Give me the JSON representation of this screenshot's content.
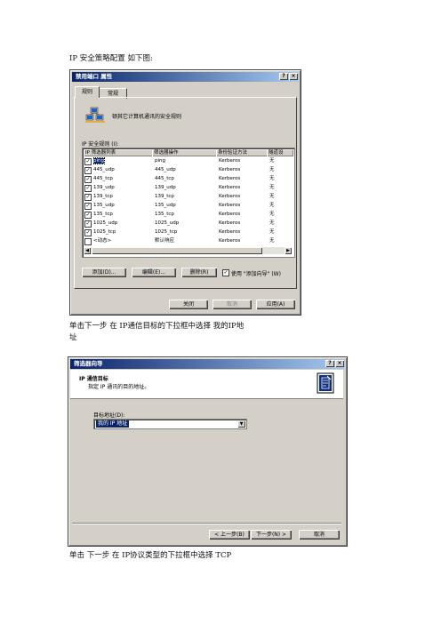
{
  "paragraphs": {
    "intro": "IP 安全策略配置 如下图:",
    "step1_line1": "单击下一步 在 IP通信目标的下拉框中选择 我的IP地",
    "step1_line2": "址",
    "step2": "单击 下一步 在 IP协议类型的下拉框中选择 TCP"
  },
  "dialog1": {
    "title": "禁用端口 属性",
    "title_buttons": [
      "?",
      "×"
    ],
    "tabs": [
      "规则",
      "常规"
    ],
    "description": "顿其它计算机通讯的安全规则",
    "list_label": "IP 安全规则 (I):",
    "columns": [
      "IP 筛选器列表",
      "筛选器操作",
      "身份验证方法",
      "隧道设"
    ],
    "rows": [
      {
        "checked": true,
        "filter": "ping",
        "action": "ping",
        "auth": "Kerberos",
        "tunnel": "无",
        "selected": true
      },
      {
        "checked": true,
        "filter": "445_udp",
        "action": "445_udp",
        "auth": "Kerberos",
        "tunnel": "无"
      },
      {
        "checked": true,
        "filter": "445_tcp",
        "action": "445_tcp",
        "auth": "Kerberos",
        "tunnel": "无"
      },
      {
        "checked": true,
        "filter": "139_udp",
        "action": "139_udp",
        "auth": "Kerberos",
        "tunnel": "无"
      },
      {
        "checked": true,
        "filter": "139_tcp",
        "action": "139_tcp",
        "auth": "Kerberos",
        "tunnel": "无"
      },
      {
        "checked": true,
        "filter": "135_udp",
        "action": "135_udp",
        "auth": "Kerberos",
        "tunnel": "无"
      },
      {
        "checked": true,
        "filter": "135_tcp",
        "action": "135_tcp",
        "auth": "Kerberos",
        "tunnel": "无"
      },
      {
        "checked": true,
        "filter": "1025_udp",
        "action": "1025_udp",
        "auth": "Kerberos",
        "tunnel": "无"
      },
      {
        "checked": true,
        "filter": "1025_tcp",
        "action": "1025_tcp",
        "auth": "Kerberos",
        "tunnel": "无"
      },
      {
        "checked": false,
        "filter": "<动态>",
        "action": "默认响应",
        "auth": "Kerberos",
        "tunnel": "无"
      }
    ],
    "buttons": {
      "add": "添加(D)...",
      "edit": "编辑(E)...",
      "remove": "删除(R)"
    },
    "wizard_checkbox": {
      "label": "使用 \"添加向导\" (W)",
      "checked": true
    },
    "footer": {
      "close": "关闭",
      "cancel": "取消",
      "apply": "应用(A)"
    }
  },
  "dialog2": {
    "title": "筛选器向导",
    "title_buttons": [
      "?",
      "×"
    ],
    "heading": "IP 通信目标",
    "subheading": "指定 IP 通讯的目的地址。",
    "field_label": "目标地址(D):",
    "selected_value": "我的 IP 地址",
    "footer": {
      "back": "< 上一步(B)",
      "next": "下一步(N) >",
      "cancel": "取消"
    }
  },
  "colors": {
    "titlebar_start": "#0a246a",
    "titlebar_end": "#a6caf0",
    "face": "#d4d0c8"
  }
}
